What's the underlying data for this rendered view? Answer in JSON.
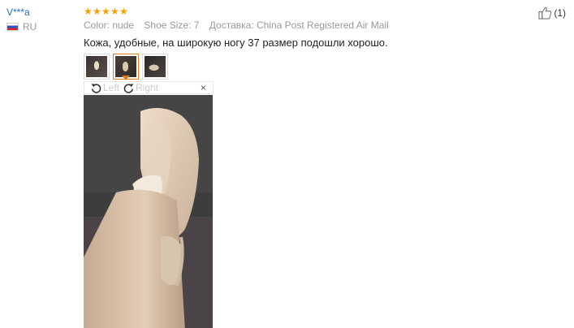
{
  "user": {
    "name": "V***a",
    "country": "RU"
  },
  "review": {
    "rating": 5,
    "stars": [
      "★",
      "★",
      "★",
      "★",
      "★"
    ],
    "attributes": {
      "color": "Color: nude",
      "shoe_size": "Shoe Size: 7",
      "shipping": "Доставка: China Post Registered Air Mail"
    },
    "text": "Кожа, удобные, на широкую ногу 37 размер подошли хорошо.",
    "thumbnails": [
      "photo-1",
      "photo-2",
      "photo-3"
    ],
    "selected_thumbnail": 2
  },
  "viewer": {
    "rotate_left_label": "Left",
    "rotate_right_label": "Right",
    "close_label": "×"
  },
  "helpful": {
    "count_label": "(1)"
  },
  "colors": {
    "username": "#1a6fc4",
    "stars": "#f5a100",
    "active_thumb_border": "#e07c1e",
    "muted_text": "#999999"
  },
  "icons": [
    "flag-ru-icon",
    "rotate-left-icon",
    "rotate-right-icon",
    "close-icon",
    "thumbs-up-icon"
  ]
}
